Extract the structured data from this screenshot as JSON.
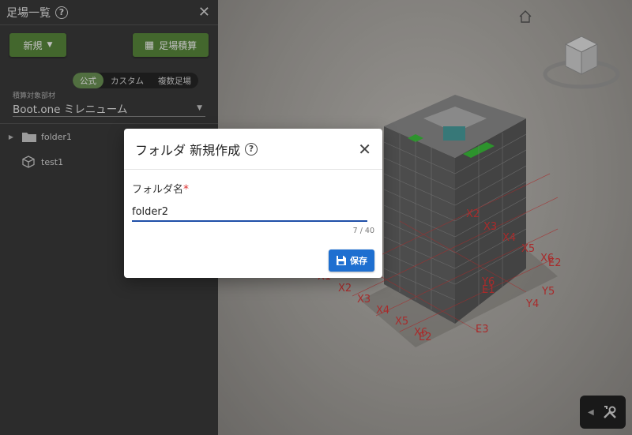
{
  "panel": {
    "title": "足場一覧",
    "new_button": "新規",
    "calc_button": "足場積算",
    "tabs": [
      {
        "label": "公式",
        "active": true
      },
      {
        "label": "カスタム",
        "active": false
      },
      {
        "label": "複数足場",
        "active": false
      }
    ],
    "target_label": "積算対象部材",
    "target_value": "Boot.one ミレニューム",
    "tree": [
      {
        "label": "folder1",
        "type": "folder"
      },
      {
        "label": "test1",
        "type": "model"
      }
    ]
  },
  "viewport": {
    "grid_labels": [
      "X1",
      "X2",
      "X3",
      "X4",
      "X5",
      "X6",
      "Y1",
      "Y2",
      "Y3",
      "Y4",
      "Y5",
      "Y6",
      "E1",
      "E2",
      "E3"
    ]
  },
  "dialog": {
    "title": "フォルダ 新規作成",
    "field_label": "フォルダ名",
    "required_mark": "*",
    "input_value": "folder2",
    "char_count": "7 / 40",
    "save_label": "保存"
  },
  "colors": {
    "accent_green": "#5a8a3c",
    "primary_blue": "#1e6fd0",
    "grid_red": "#e03a3a"
  }
}
